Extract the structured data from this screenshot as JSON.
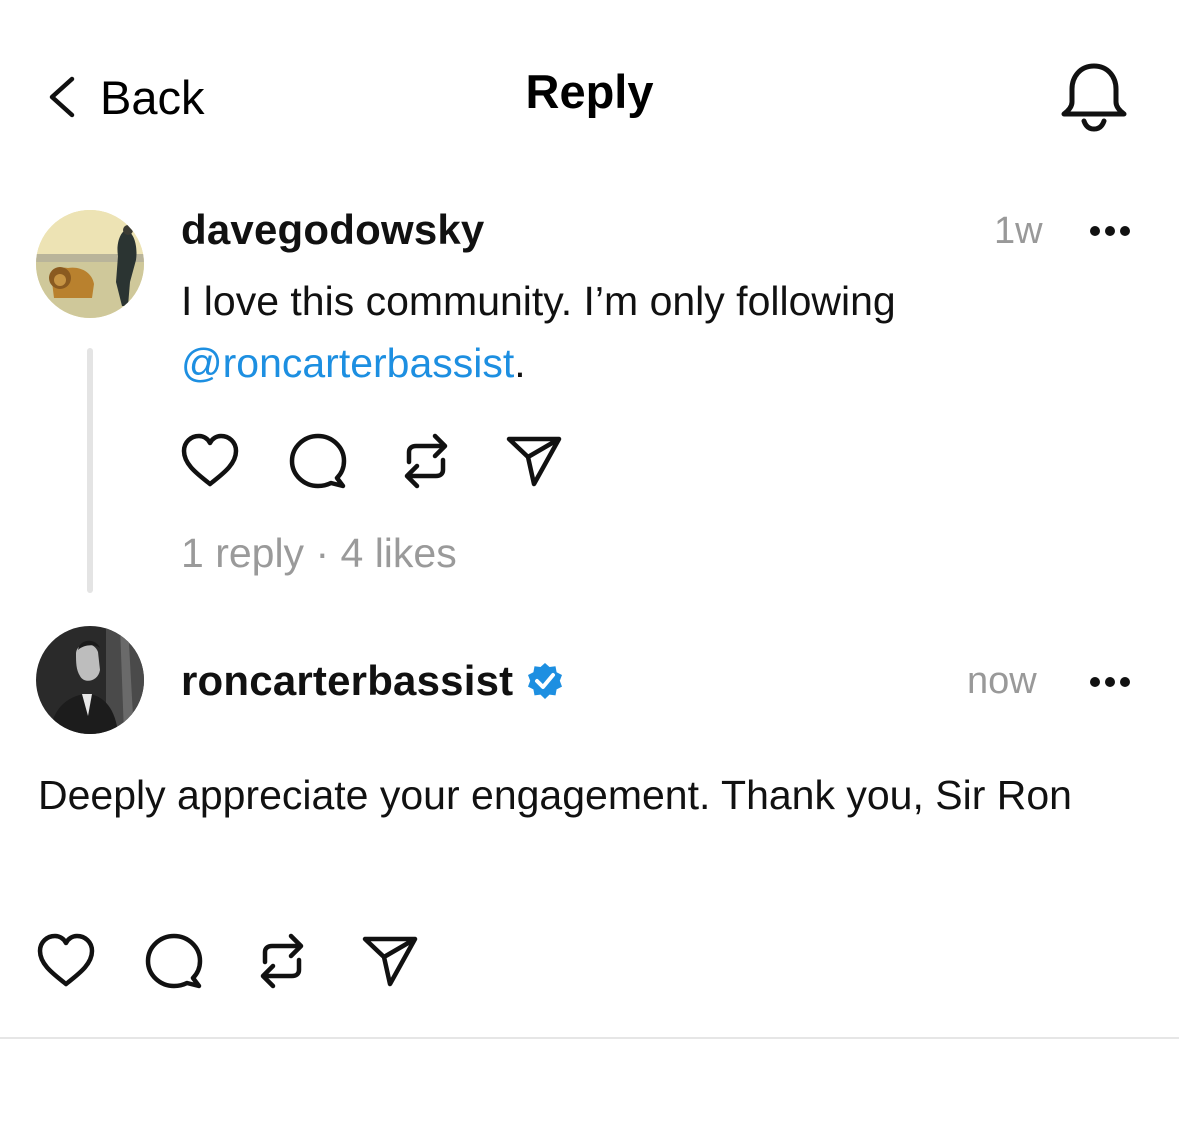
{
  "header": {
    "back_label": "Back",
    "title": "Reply"
  },
  "posts": [
    {
      "username": "davegodowsky",
      "time": "1w",
      "text_before": "I love this community. I’m only following",
      "mention": "@roncarterbassist",
      "text_after": ".",
      "stats": "1 reply · 4 likes"
    },
    {
      "username": "roncarterbassist",
      "verified": true,
      "time": "now",
      "text": "Deeply appreciate your engagement. Thank you, Sir Ron"
    }
  ],
  "colors": {
    "mention": "#1d8fe1",
    "verified": "#1d8fe1",
    "muted": "#999999"
  },
  "icons": [
    "chevron-left-icon",
    "bell-icon",
    "more-icon",
    "heart-icon",
    "comment-icon",
    "repost-icon",
    "share-icon",
    "verified-badge-icon"
  ]
}
